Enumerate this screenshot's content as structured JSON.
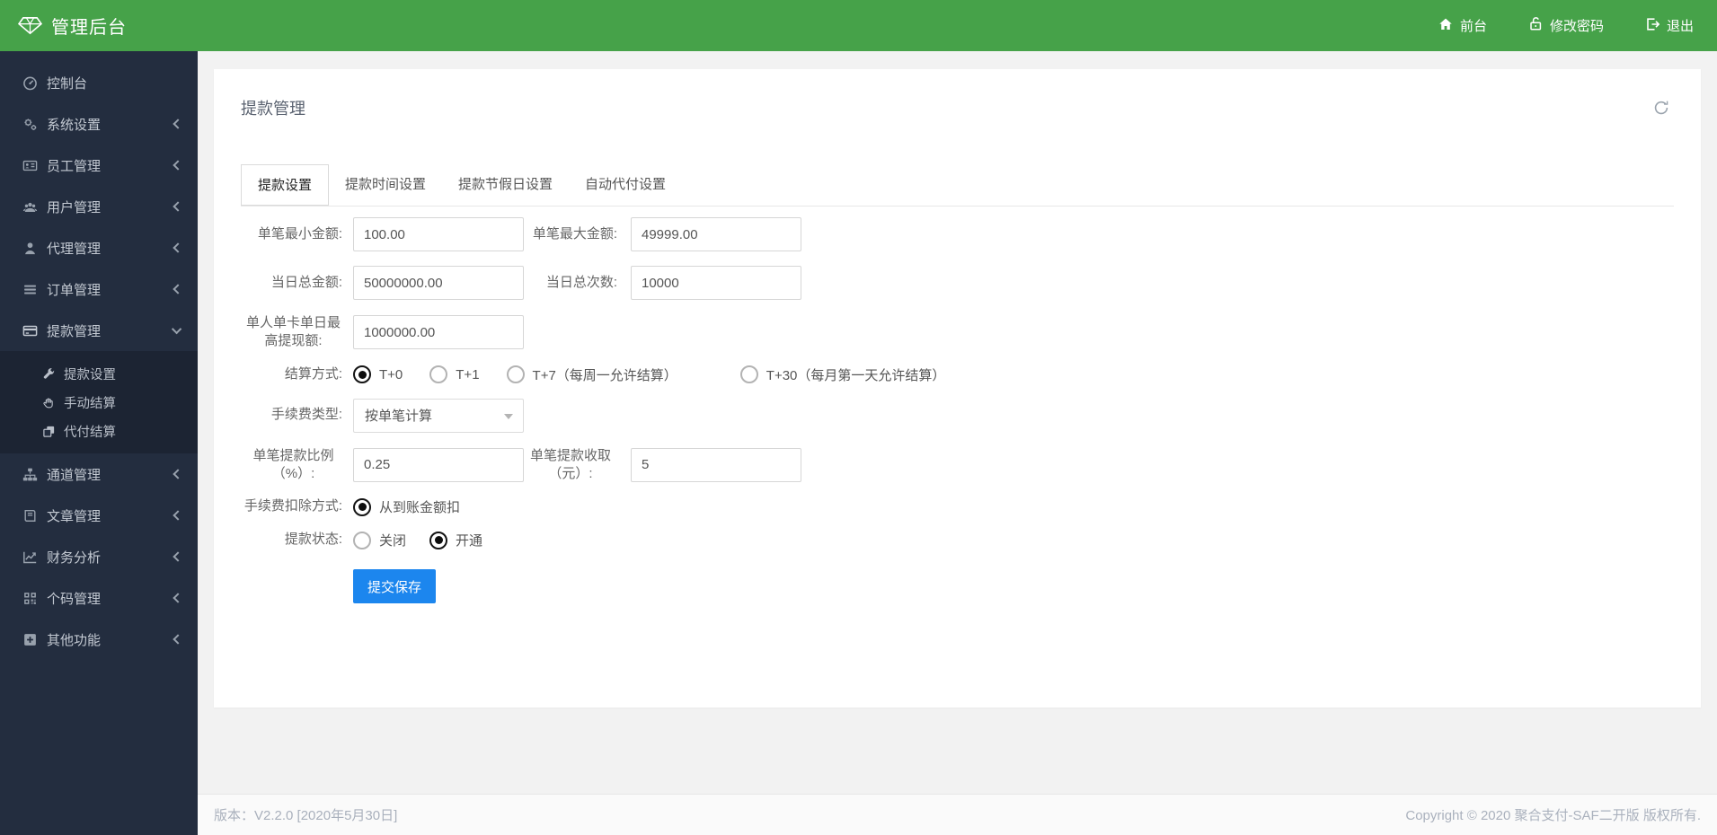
{
  "colors": {
    "topbar_green": "#46a249",
    "sidebar_dark": "#232d3f",
    "content_bg": "#f2f2f2",
    "primary_button_blue": "#1c86ee",
    "card_bg": "#ffffff"
  },
  "header": {
    "brand": "管理后台",
    "brand_icon": "gem-icon",
    "nav": [
      {
        "label": "前台",
        "icon": "home-icon"
      },
      {
        "label": "修改密码",
        "icon": "unlock-icon"
      },
      {
        "label": "退出",
        "icon": "logout-icon"
      }
    ]
  },
  "sidebar": {
    "items": [
      {
        "label": "控制台",
        "icon": "dashboard-icon",
        "expandable": false
      },
      {
        "label": "系统设置",
        "icon": "gears-icon",
        "expandable": true
      },
      {
        "label": "员工管理",
        "icon": "id-card-icon",
        "expandable": true
      },
      {
        "label": "用户管理",
        "icon": "users-icon",
        "expandable": true
      },
      {
        "label": "代理管理",
        "icon": "user-icon",
        "expandable": true
      },
      {
        "label": "订单管理",
        "icon": "list-icon",
        "expandable": true
      },
      {
        "label": "提款管理",
        "icon": "credit-card-icon",
        "expandable": true,
        "expanded": true,
        "children": [
          {
            "label": "提款设置",
            "icon": "wrench-icon"
          },
          {
            "label": "手动结算",
            "icon": "hand-icon"
          },
          {
            "label": "代付结算",
            "icon": "clone-icon"
          }
        ]
      },
      {
        "label": "通道管理",
        "icon": "sitemap-icon",
        "expandable": true
      },
      {
        "label": "文章管理",
        "icon": "book-icon",
        "expandable": true
      },
      {
        "label": "财务分析",
        "icon": "chart-line-icon",
        "expandable": true
      },
      {
        "label": "个码管理",
        "icon": "qrcode-icon",
        "expandable": true
      },
      {
        "label": "其他功能",
        "icon": "plus-square-icon",
        "expandable": true
      }
    ]
  },
  "main": {
    "card_title": "提款管理",
    "refresh_icon": "refresh-icon",
    "tabs": [
      {
        "label": "提款设置",
        "active": true
      },
      {
        "label": "提款时间设置",
        "active": false
      },
      {
        "label": "提款节假日设置",
        "active": false
      },
      {
        "label": "自动代付设置",
        "active": false
      }
    ],
    "form": {
      "min_amount": {
        "label": "单笔最小金额:",
        "value": "100.00"
      },
      "max_amount": {
        "label": "单笔最大金额:",
        "value": "49999.00"
      },
      "daily_total_amount": {
        "label": "当日总金额:",
        "value": "50000000.00"
      },
      "daily_total_count": {
        "label": "当日总次数:",
        "value": "10000"
      },
      "per_card_daily_max": {
        "label": "单人单卡单日最高提现额:",
        "value": "1000000.00"
      },
      "settle_mode": {
        "label": "结算方式:",
        "options": [
          "T+0",
          "T+1",
          "T+7（每周一允许结算）",
          "T+30（每月第一天允许结算）"
        ],
        "selected": "T+0"
      },
      "fee_type": {
        "label": "手续费类型:",
        "value": "按单笔计算"
      },
      "fee_percent": {
        "label": "单笔提款比例（%）:",
        "value": "0.25"
      },
      "fee_fixed": {
        "label": "单笔提款收取（元）:",
        "value": "5"
      },
      "fee_deduct_mode": {
        "label": "手续费扣除方式:",
        "options": [
          "从到账金额扣"
        ],
        "selected": "从到账金额扣"
      },
      "withdraw_status": {
        "label": "提款状态:",
        "options": [
          "关闭",
          "开通"
        ],
        "selected": "开通"
      },
      "submit_label": "提交保存"
    }
  },
  "footer": {
    "version": "版本：V2.2.0 [2020年5月30日]",
    "copyright": "Copyright © 2020 聚合支付-SAF二开版 版权所有."
  }
}
